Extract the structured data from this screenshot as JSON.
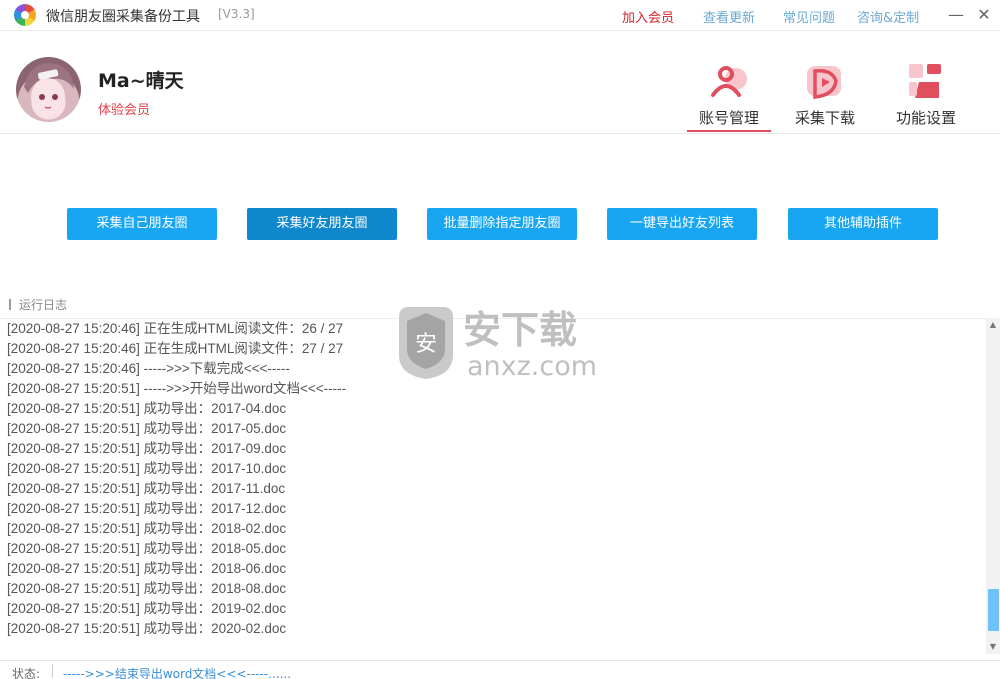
{
  "window": {
    "title": "微信朋友圈采集备份工具",
    "version": "[V3.3]",
    "links": [
      "加入会员",
      "查看更新",
      "常见问题",
      "咨询&定制"
    ],
    "minimize": "—",
    "close": "✕"
  },
  "profile": {
    "username": "Ma~晴天",
    "member_level": "体验会员"
  },
  "nav": {
    "tabs": [
      {
        "label": "账号管理",
        "icon": "user-icon",
        "active": true
      },
      {
        "label": "采集下载",
        "icon": "download-icon",
        "active": false
      },
      {
        "label": "功能设置",
        "icon": "settings-icon",
        "active": false
      }
    ]
  },
  "actions": {
    "buttons": [
      "采集自己朋友圈",
      "采集好友朋友圈",
      "批量删除指定朋友圈",
      "一键导出好友列表",
      "其他辅助插件"
    ]
  },
  "log": {
    "heading": "运行日志",
    "lines": [
      "[2020-08-27  15:20:46] 正在生成HTML阅读文件：26 / 27",
      "[2020-08-27  15:20:46] 正在生成HTML阅读文件：27 / 27",
      "[2020-08-27  15:20:46] ----->>>下载完成<<<-----",
      "[2020-08-27  15:20:51] ----->>>开始导出word文档<<<-----",
      "[2020-08-27  15:20:51] 成功导出：2017-04.doc",
      "[2020-08-27  15:20:51] 成功导出：2017-05.doc",
      "[2020-08-27  15:20:51] 成功导出：2017-09.doc",
      "[2020-08-27  15:20:51] 成功导出：2017-10.doc",
      "[2020-08-27  15:20:51] 成功导出：2017-11.doc",
      "[2020-08-27  15:20:51] 成功导出：2017-12.doc",
      "[2020-08-27  15:20:51] 成功导出：2018-02.doc",
      "[2020-08-27  15:20:51] 成功导出：2018-05.doc",
      "[2020-08-27  15:20:51] 成功导出：2018-06.doc",
      "[2020-08-27  15:20:51] 成功导出：2018-08.doc",
      "[2020-08-27  15:20:51] 成功导出：2019-02.doc",
      "[2020-08-27  15:20:51] 成功导出：2020-02.doc"
    ]
  },
  "watermark": {
    "brand": "安下载",
    "domain": "anxz.com"
  },
  "status": {
    "label": "状态:",
    "text": "----->>>结束导出word文档<<<-----......"
  }
}
